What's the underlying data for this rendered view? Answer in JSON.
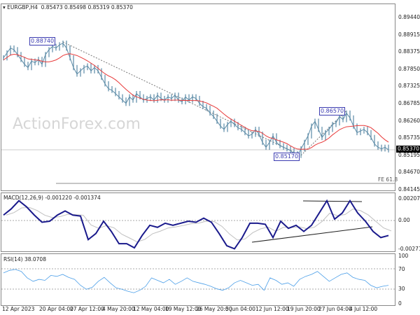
{
  "header": {
    "symbol": "EURGBP,H4",
    "ohlc": "0.85473 0.85498 0.85319 0.85370"
  },
  "watermark": "ActionForex.com",
  "price_axis": [
    "0.89440",
    "0.88915",
    "0.88375",
    "0.87850",
    "0.87325",
    "0.86785",
    "0.86260",
    "0.85735",
    "0.85195",
    "0.84670",
    "0.84145"
  ],
  "current_price": "0.85370",
  "annotations": {
    "high": "0.88740",
    "low": "0.85170",
    "swing": "0.86570",
    "fe": "FE 61.8"
  },
  "macd": {
    "label": "MACD(12,26,9) -0.001220 -0.001374",
    "axis": [
      "0.002074",
      "0.00",
      "-0.002716"
    ],
    "values": [
      0.0006,
      0.0012,
      0.002,
      0.0014,
      0.0006,
      -0.0001,
      0.0,
      0.0006,
      0.001,
      0.0006,
      0.0005,
      -0.0018,
      -0.0012,
      0.0,
      -0.001,
      -0.0022,
      -0.0022,
      -0.0026,
      -0.0014,
      -0.0004,
      -0.0006,
      -0.0002,
      -0.0004,
      -0.0002,
      0.0,
      -0.0001,
      0.0003,
      -0.0001,
      -0.0012,
      -0.0024,
      -0.0027,
      -0.0016,
      -0.0002,
      -0.0002,
      -0.0003,
      -0.0016,
      0.0,
      -0.0007,
      -0.0004,
      -0.001,
      -0.0004,
      0.0008,
      0.002,
      0.0002,
      0.0008,
      0.002,
      0.0008,
      0.0,
      -0.001,
      -0.0016,
      -0.0014
    ]
  },
  "rsi": {
    "label": "RSI(14) 38.0708",
    "axis": [
      "100",
      "70",
      "30",
      "0"
    ],
    "values": [
      65,
      70,
      72,
      68,
      55,
      48,
      52,
      50,
      60,
      58,
      62,
      56,
      52,
      40,
      32,
      36,
      48,
      56,
      45,
      35,
      32,
      28,
      25,
      30,
      38,
      55,
      50,
      45,
      52,
      42,
      48,
      55,
      48,
      45,
      42,
      38,
      33,
      30,
      35,
      45,
      50,
      45,
      40,
      42,
      30,
      55,
      50,
      42,
      45,
      38,
      52,
      58,
      62,
      68,
      58,
      48,
      55,
      62,
      65,
      56,
      52,
      50,
      40,
      35,
      38,
      40
    ]
  },
  "dates": [
    "12 Apr 2023",
    "20 Apr 04:00",
    "27 Apr 12:00",
    "4 May 20:00",
    "12 May 04:00",
    "19 May 12:00",
    "26 May 20:00",
    "5 Jun 04:00",
    "12 Jun 12:00",
    "19 Jun 20:00",
    "27 Jun 04:00",
    "4 Jul 12:00"
  ],
  "colors": {
    "price": "#5b8aa6",
    "ma": "#e83a3a",
    "macd": "#1a1a8c",
    "signal": "#c0c0c0",
    "rsi": "#4a9ee8",
    "tag": "#3b3bb0"
  },
  "price_closes": [
    0.882,
    0.8835,
    0.885,
    0.8845,
    0.883,
    0.8815,
    0.88,
    0.879,
    0.881,
    0.8805,
    0.8815,
    0.88,
    0.883,
    0.8845,
    0.8855,
    0.885,
    0.886,
    0.8865,
    0.885,
    0.882,
    0.879,
    0.877,
    0.878,
    0.879,
    0.8795,
    0.878,
    0.879,
    0.878,
    0.876,
    0.874,
    0.8725,
    0.872,
    0.871,
    0.87,
    0.869,
    0.868,
    0.87,
    0.869,
    0.871,
    0.87,
    0.869,
    0.8695,
    0.87,
    0.869,
    0.8705,
    0.8695,
    0.869,
    0.87,
    0.8695,
    0.8705,
    0.869,
    0.8685,
    0.87,
    0.869,
    0.87,
    0.8695,
    0.868,
    0.867,
    0.8665,
    0.865,
    0.864,
    0.8625,
    0.861,
    0.86,
    0.8615,
    0.8625,
    0.8615,
    0.8605,
    0.86,
    0.859,
    0.858,
    0.8585,
    0.86,
    0.8585,
    0.856,
    0.8545,
    0.856,
    0.858,
    0.856,
    0.855,
    0.8545,
    0.854,
    0.8535,
    0.8525,
    0.852,
    0.854,
    0.856,
    0.858,
    0.861,
    0.8625,
    0.86,
    0.8575,
    0.859,
    0.86,
    0.8615,
    0.862,
    0.864,
    0.863,
    0.865,
    0.8635,
    0.861,
    0.859,
    0.8595,
    0.86,
    0.859,
    0.8575,
    0.8555,
    0.8545,
    0.854,
    0.8545,
    0.8537
  ]
}
